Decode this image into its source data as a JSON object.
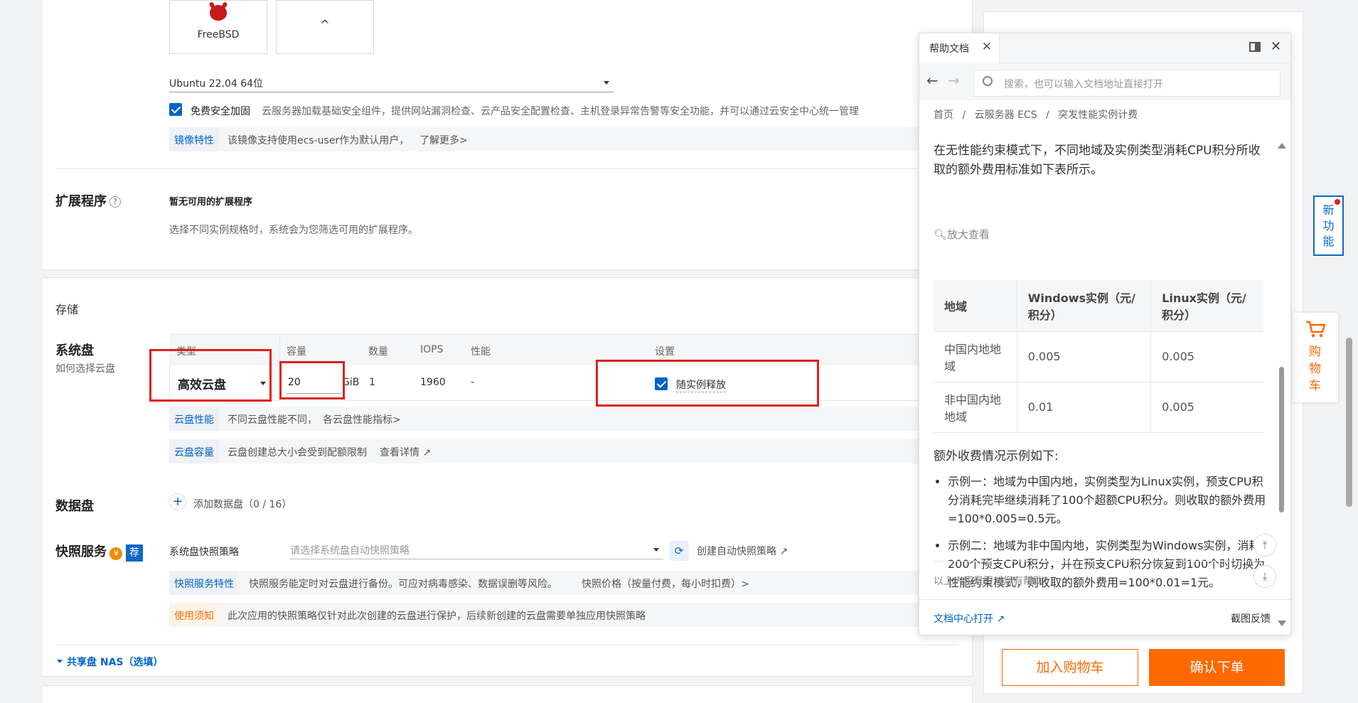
{
  "os": {
    "freebsd_label": "FreeBSD",
    "more_label": "^",
    "version_selected": "Ubuntu 22.04 64位",
    "security_label": "免费安全加固",
    "security_desc": "云服务器加载基础安全组件，提供网站漏洞检查、云产品安全配置检查、主机登录异常告警等安全功能，并可以通过云安全中心统一管理",
    "image_tag": "镜像特性",
    "image_desc": "该镜像支持使用ecs-user作为默认用户，",
    "image_link": "了解更多>"
  },
  "extensions": {
    "title": "扩展程序",
    "qmark": "?",
    "none": "暂无可用的扩展程序",
    "desc": "选择不同实例规格时，系统会为您筛选可用的扩展程序。"
  },
  "storage": {
    "title": "存储",
    "system_disk": "系统盘",
    "how_choose": "如何选择云盘",
    "headers": {
      "type": "类型",
      "capacity": "容量",
      "count": "数量",
      "iops": "IOPS",
      "perf": "性能",
      "settings": "设置"
    },
    "row": {
      "type": "高效云盘",
      "capacity": "20",
      "unit": "GiB",
      "count": "1",
      "iops": "1960",
      "perf": "-",
      "release": "随实例释放"
    },
    "perf_tag": "云盘性能",
    "perf_desc": "不同云盘性能不同，",
    "perf_link": "各云盘性能指标>",
    "cap_tag": "云盘容量",
    "cap_desc": "云盘创建总大小会受到配额限制",
    "cap_link": "查看详情",
    "data_disk": "数据盘",
    "add_data_disk": "添加数据盘（0 / 16）",
    "snapshot": "快照服务",
    "yen": "¥",
    "rec": "荐",
    "snap_policy_label": "系统盘快照策略",
    "snap_placeholder": "请选择系统盘自动快照策略",
    "snap_create_link": "创建自动快照策略",
    "snap_tag": "快照服务特性",
    "snap_desc": "快照服务能定时对云盘进行备份。可应对病毒感染、数据误删等风险。",
    "snap_price_link": "快照价格（按量付费，每小时扣费）>",
    "notice_tag": "使用须知",
    "notice_desc": "此次应用的快照策略仅针对此次创建的云盘进行保护，后续新创建的云盘需要单独应用快照策略",
    "nas": "共享盘 NAS（选填）"
  },
  "order": {
    "add_cart": "加入购物车",
    "confirm": "确认下单"
  },
  "floating": {
    "new_feature": [
      "新",
      "功",
      "能"
    ],
    "cart": [
      "购",
      "物",
      "车"
    ]
  },
  "help": {
    "tab_title": "帮助文档",
    "search_placeholder": "搜索，也可以输入文档地址直接打开",
    "breadcrumb": [
      "首页",
      "/",
      "云服务器 ECS",
      "/",
      "突发性能实例计费"
    ],
    "intro": "在无性能约束模式下，不同地域及实例类型消耗CPU积分所收取的额外费用标准如下表所示。",
    "zoom": "放大查看",
    "table": {
      "headers": [
        "地域",
        "Windows实例（元/积分）",
        "Linux实例（元/积分）"
      ],
      "rows": [
        [
          "中国内地地域",
          "0.005",
          "0.005"
        ],
        [
          "非中国内地地域",
          "0.01",
          "0.005"
        ]
      ]
    },
    "extra_title": "额外收费情况示例如下:",
    "examples": [
      "示例一：地域为中国内地，实例类型为Linux实例，预支CPU积分消耗完毕继续消耗了100个超额CPU积分。则收取的额外费用=100*0.005=0.5元。",
      "示例二：地域为非中国内地，实例类型为Windows实例，消耗了200个预支CPU积分，并在预支CPU积分恢复到100个时切换为性能约束模式，则收取的额外费用=100*0.01=1元。"
    ],
    "feedback_q": "以上内容是否对您有帮助?",
    "doc_center": "文档中心打开",
    "screenshot_feedback": "截图反馈"
  }
}
